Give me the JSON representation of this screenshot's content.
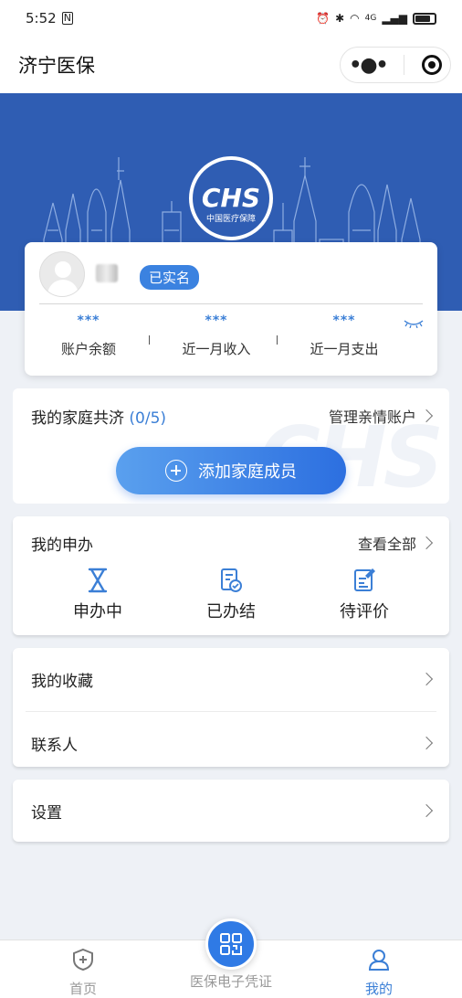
{
  "status_bar": {
    "time": "5:52",
    "network": "4G"
  },
  "app": {
    "title": "济宁医保"
  },
  "banner": {
    "logo_text": "CHS",
    "logo_subtitle": "中国医疗保障",
    "brand_color": "#2f5db3"
  },
  "user_card": {
    "verified_badge": "已实名",
    "stats": [
      {
        "value": "***",
        "label": "账户余额"
      },
      {
        "value": "***",
        "label": "近一月收入"
      },
      {
        "value": "***",
        "label": "近一月支出"
      }
    ]
  },
  "family": {
    "title": "我的家庭共济",
    "count": "(0/5)",
    "manage_label": "管理亲情账户",
    "add_button": "添加家庭成员",
    "watermark": "CHS"
  },
  "applications": {
    "title": "我的申办",
    "view_all": "查看全部",
    "items": [
      {
        "label": "申办中",
        "icon": "hourglass-icon"
      },
      {
        "label": "已办结",
        "icon": "document-check-icon"
      },
      {
        "label": "待评价",
        "icon": "edit-document-icon"
      }
    ]
  },
  "menu": {
    "favorites": "我的收藏",
    "contacts": "联系人",
    "settings": "设置"
  },
  "tab_bar": {
    "home": "首页",
    "card": "医保电子凭证",
    "mine": "我的",
    "accent_color": "#3b7fd6"
  }
}
